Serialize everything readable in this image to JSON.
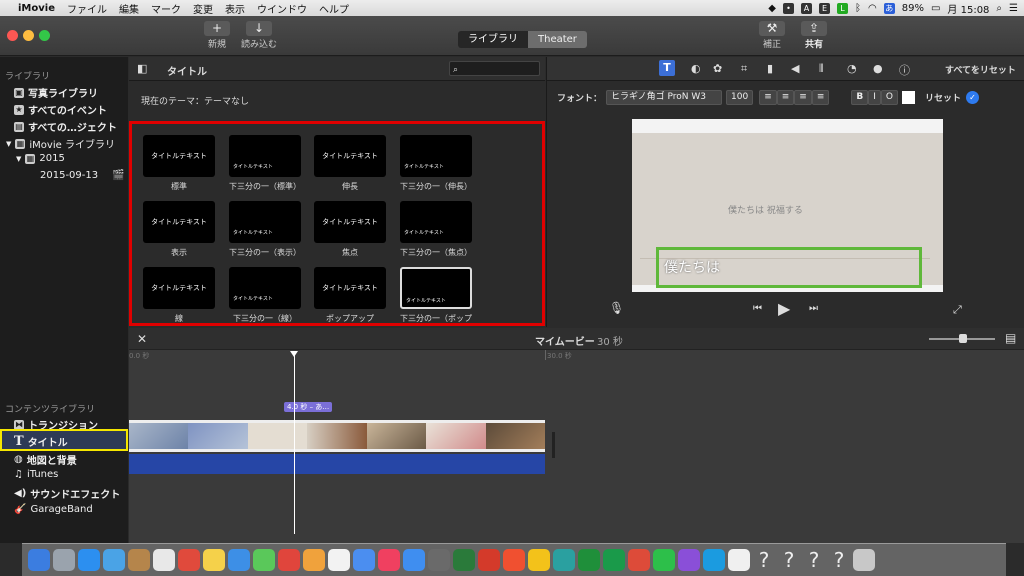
{
  "menubar": {
    "apple": "",
    "items": [
      "iMovie",
      "ファイル",
      "編集",
      "マーク",
      "変更",
      "表示",
      "ウインドウ",
      "ヘルプ"
    ],
    "battery": "89%",
    "clock": "月 15:08",
    "input": "あ"
  },
  "toolbar": {
    "new_label": "新規",
    "import_label": "読み込む",
    "library_tab": "ライブラリ",
    "theater_tab": "Theater",
    "enhance_label": "補正",
    "share_label": "共有"
  },
  "sidebar": {
    "library_header": "ライブラリ",
    "library_items": [
      "写真ライブラリ",
      "すべてのイベント",
      "すべての…ジェクト",
      "iMovie ライブラリ",
      "2015",
      "2015-09-13"
    ],
    "content_header": "コンテンツライブラリ",
    "content_items": [
      "トランジション",
      "タイトル",
      "地図と背景",
      "iTunes",
      "サウンドエフェクト",
      "GarageBand"
    ]
  },
  "browser": {
    "title": "タイトル",
    "theme_text": "現在のテーマ：テーマなし",
    "titles": [
      {
        "caption": "標準",
        "sample": "タイトルテキスト"
      },
      {
        "caption": "下三分の一（標準）",
        "sample": "タイトルテキスト"
      },
      {
        "caption": "伸長",
        "sample": "タイトルテキスト"
      },
      {
        "caption": "下三分の一（伸長）",
        "sample": "タイトルテキスト"
      },
      {
        "caption": "表示",
        "sample": "タイトルテキスト"
      },
      {
        "caption": "下三分の一（表示）",
        "sample": "タイトルテキスト"
      },
      {
        "caption": "焦点",
        "sample": "タイトルテキスト"
      },
      {
        "caption": "下三分の一（焦点）",
        "sample": "タイトルテキスト"
      },
      {
        "caption": "線",
        "sample": "タイトルテキスト"
      },
      {
        "caption": "下三分の一（線）",
        "sample": "タイトルテキスト"
      },
      {
        "caption": "ポップアップ",
        "sample": "タイトルテキスト"
      },
      {
        "caption": "下三分の一（ポップ",
        "sample": "タイトルテキスト"
      }
    ]
  },
  "viewer": {
    "reset_all": "すべてをリセット",
    "font_label": "フォント：",
    "font_value": "ヒラギノ角ゴ ProN W3",
    "size_value": "100",
    "bold": "B",
    "italic": "I",
    "outline": "O",
    "reset": "リセット",
    "preview_text": "僕たちは 祝福する",
    "title_overlay": "僕たちは"
  },
  "timeline": {
    "project_name": "マイムービー",
    "duration": "30 秒",
    "ruler_start": "0.0 秒",
    "ruler_mid": "30.0 秒",
    "title_clip": "4.0 秒 – あ…"
  },
  "colors": {
    "highlight_red": "#e00000",
    "highlight_yellow": "#f5e600",
    "highlight_green": "#5fb83a",
    "title_clip": "#7b6fd8",
    "audio": "#2646a6"
  }
}
